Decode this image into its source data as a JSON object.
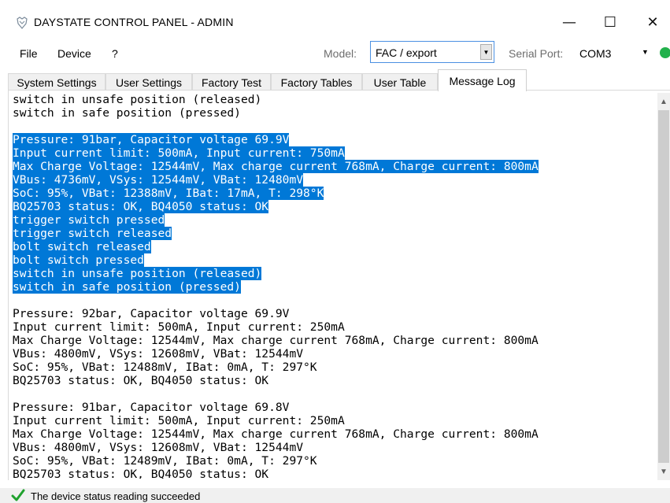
{
  "window": {
    "title": "DAYSTATE CONTROL PANEL - ADMIN",
    "controls": {
      "minimize": "—",
      "maximize": "☐",
      "close": "✕"
    }
  },
  "menu": {
    "file": "File",
    "device": "Device",
    "help": "?"
  },
  "toolbar": {
    "model_label": "Model:",
    "model_value": "FAC / export",
    "serial_label": "Serial Port:",
    "serial_value": "COM3",
    "connection_color": "#22b14c"
  },
  "tabs": [
    {
      "label": "System Settings"
    },
    {
      "label": "User Settings"
    },
    {
      "label": "Factory Test"
    },
    {
      "label": "Factory Tables"
    },
    {
      "label": "User Table"
    },
    {
      "label": "Message Log",
      "active": true
    }
  ],
  "log": {
    "selection_color": "#0078d7",
    "lines": [
      {
        "text": "switch in unsafe position (released)",
        "selected": false
      },
      {
        "text": "switch in safe position (pressed)",
        "selected": false
      },
      {
        "text": "",
        "selected": false
      },
      {
        "text": "Pressure: 91bar, Capacitor voltage 69.9V",
        "selected": true
      },
      {
        "text": "Input current limit: 500mA, Input current: 750mA",
        "selected": true
      },
      {
        "text": "Max Charge Voltage: 12544mV, Max charge current 768mA, Charge current: 800mA",
        "selected": true
      },
      {
        "text": "VBus: 4736mV, VSys: 12544mV, VBat: 12480mV",
        "selected": true
      },
      {
        "text": "SoC: 95%, VBat: 12388mV, IBat: 17mA, T: 298°K",
        "selected": true
      },
      {
        "text": "BQ25703 status: OK, BQ4050 status: OK",
        "selected": true
      },
      {
        "text": "trigger switch pressed",
        "selected": true
      },
      {
        "text": "trigger switch released",
        "selected": true
      },
      {
        "text": "bolt switch released",
        "selected": true
      },
      {
        "text": "bolt switch pressed",
        "selected": true
      },
      {
        "text": "switch in unsafe position (released)",
        "selected": true
      },
      {
        "text": "switch in safe position (pressed)",
        "selected": true
      },
      {
        "text": "",
        "selected": false
      },
      {
        "text": "Pressure: 92bar, Capacitor voltage 69.9V",
        "selected": false
      },
      {
        "text": "Input current limit: 500mA, Input current: 250mA",
        "selected": false
      },
      {
        "text": "Max Charge Voltage: 12544mV, Max charge current 768mA, Charge current: 800mA",
        "selected": false
      },
      {
        "text": "VBus: 4800mV, VSys: 12608mV, VBat: 12544mV",
        "selected": false
      },
      {
        "text": "SoC: 95%, VBat: 12488mV, IBat: 0mA, T: 297°K",
        "selected": false
      },
      {
        "text": "BQ25703 status: OK, BQ4050 status: OK",
        "selected": false
      },
      {
        "text": "",
        "selected": false
      },
      {
        "text": "Pressure: 91bar, Capacitor voltage 69.8V",
        "selected": false
      },
      {
        "text": "Input current limit: 500mA, Input current: 250mA",
        "selected": false
      },
      {
        "text": "Max Charge Voltage: 12544mV, Max charge current 768mA, Charge current: 800mA",
        "selected": false
      },
      {
        "text": "VBus: 4800mV, VSys: 12608mV, VBat: 12544mV",
        "selected": false
      },
      {
        "text": "SoC: 95%, VBat: 12489mV, IBat: 0mA, T: 297°K",
        "selected": false
      },
      {
        "text": "BQ25703 status: OK, BQ4050 status: OK",
        "selected": false
      }
    ]
  },
  "status": {
    "text": "The device status reading succeeded",
    "icon": "check-icon",
    "icon_color": "#1fa12e"
  }
}
